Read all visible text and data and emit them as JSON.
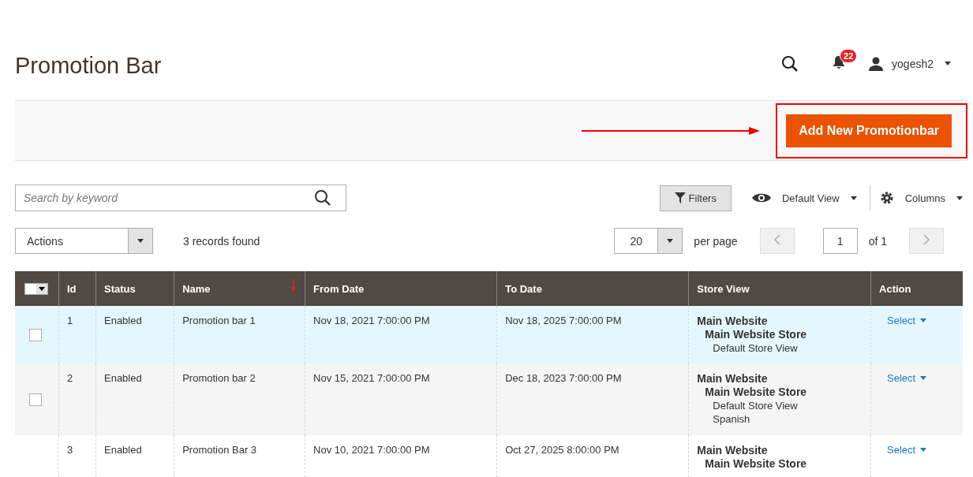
{
  "page_title": "Promotion Bar",
  "header": {
    "notifications_count": "22",
    "user": "yogesh2"
  },
  "primary_button": {
    "label": "Add New Promotionbar",
    "highlighted": true
  },
  "search": {
    "placeholder": "Search by keyword"
  },
  "toolbar": {
    "filters": "Filters",
    "view": "Default View",
    "columns": "Columns"
  },
  "actions": {
    "label": "Actions"
  },
  "records_found": "3 records found",
  "pager": {
    "per_page_value": "20",
    "per_page_label": "per page",
    "page": "1",
    "of": "of 1"
  },
  "table": {
    "columns": [
      {
        "label": "Id",
        "sorted": false
      },
      {
        "label": "Status",
        "sorted": false
      },
      {
        "label": "Name",
        "sorted": true
      },
      {
        "label": "From Date",
        "sorted": false
      },
      {
        "label": "To Date",
        "sorted": false
      },
      {
        "label": "Store View",
        "sorted": false
      },
      {
        "label": "Action",
        "sorted": false
      }
    ],
    "rows": [
      {
        "checked": false,
        "highlighted": true,
        "id": "1",
        "status": "Enabled",
        "name": "Promotion bar 1",
        "from": "Nov 18, 2021 7:00:00 PM",
        "to": "Nov 18, 2025 7:00:00 PM",
        "website": "Main Website",
        "store": "Main Website Store",
        "views": [
          "Default Store View"
        ],
        "action": "Select"
      },
      {
        "checked": false,
        "highlighted": false,
        "id": "2",
        "status": "Enabled",
        "name": "Promotion bar 2",
        "from": "Nov 15, 2021 7:00:00 PM",
        "to": "Dec 18, 2023 7:00:00 PM",
        "website": "Main Website",
        "store": "Main Website Store",
        "views": [
          "Default Store View",
          "Spanish"
        ],
        "action": "Select"
      },
      {
        "highlighted": false,
        "id": "3",
        "status": "Enabled",
        "name": "Promotion Bar 3",
        "from": "Nov 10, 2021 7:00:00 PM",
        "to": "Oct 27, 2025 8:00:00 PM",
        "website": "Main Website",
        "store": "Main Website Store",
        "views": [],
        "action": "Select"
      }
    ]
  }
}
